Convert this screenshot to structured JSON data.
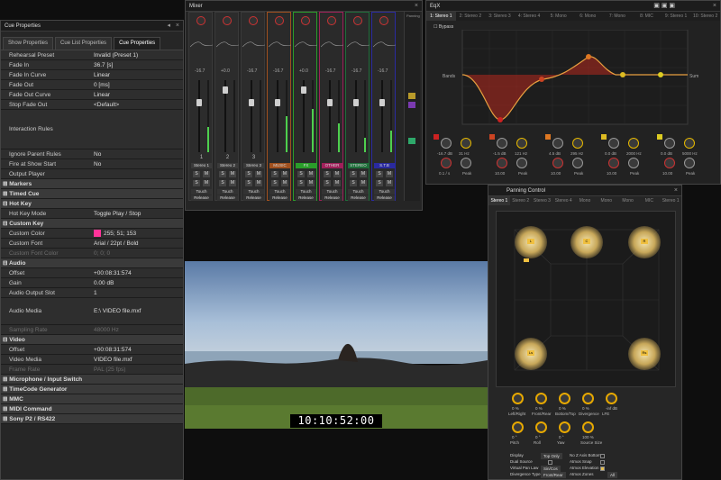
{
  "cue_panel": {
    "title": "Cue Properties",
    "tabs": [
      "Show Properties",
      "Cue List Properties",
      "Cue Properties"
    ],
    "rows": [
      {
        "k": "Rehearsal Preset",
        "v": "Invalid (Preset 1)"
      },
      {
        "k": "Fade In",
        "v": "36.7 [s]"
      },
      {
        "k": "Fade In Curve",
        "v": "Linear"
      },
      {
        "k": "Fade Out",
        "v": "0 [ms]"
      },
      {
        "k": "Fade Out Curve",
        "v": "Linear"
      },
      {
        "k": "Stop Fade Out",
        "v": "<Default>"
      },
      {
        "k": "Interaction Rules",
        "v": ""
      },
      {
        "k": "Ignore Parent Rules",
        "v": "No"
      },
      {
        "k": "Fire at Show Start",
        "v": "No"
      },
      {
        "k": "Output Player",
        "v": ""
      }
    ],
    "sections": {
      "markers": "Markers",
      "timed_cue": "Timed Cue",
      "hot_key": "Hot Key",
      "custom_key": "Custom Key",
      "audio": "Audio",
      "video": "Video",
      "microphone": "Microphone / Input Switch",
      "timecode": "TimeCode Generator",
      "mmc": "MMC",
      "midi": "MIDI Command",
      "sony": "Sony P2 / RS422"
    },
    "hot_key_mode": {
      "k": "Hot Key Mode",
      "v": "Toggle Play / Stop"
    },
    "custom_color": {
      "k": "Custom Color",
      "v": "255; 51; 153",
      "swatch": "#ff3399"
    },
    "custom_font": {
      "k": "Custom Font",
      "v": "Arial / 22pt / Bold"
    },
    "custom_font_color": {
      "k": "Custom Font Color",
      "v": "0; 0; 0"
    },
    "audio_rows": [
      {
        "k": "Offset",
        "v": "+00:08:31:574"
      },
      {
        "k": "Gain",
        "v": "0.00 dB"
      },
      {
        "k": "Audio Output Slot",
        "v": "1"
      },
      {
        "k": "Audio Media",
        "v": "E:\\  VIDEO file.mxf"
      },
      {
        "k": "Sampling Rate",
        "v": "48000 Hz"
      }
    ],
    "video_rows": [
      {
        "k": "Offset",
        "v": "+00:08:31:574"
      },
      {
        "k": "Video Media",
        "v": "VIDEO file.mxf"
      },
      {
        "k": "Frame Rate",
        "v": "PAL (25 fps)"
      }
    ]
  },
  "mixer": {
    "title": "Mixer",
    "channels": [
      {
        "num": "1",
        "name": "Stereo 1",
        "val": "-16.7",
        "color": "#2c2c2c",
        "fill": 0.35
      },
      {
        "num": "2",
        "name": "Stereo 2",
        "val": "+0.0",
        "color": "#2c2c2c",
        "fill": 0.0
      },
      {
        "num": "3",
        "name": "Stereo 3",
        "val": "-16.7",
        "color": "#2c2c2c",
        "fill": 0.0
      },
      {
        "num": "",
        "name": "MUSIC",
        "val": "-16.7",
        "color": "#a0501e",
        "fill": 0.5
      },
      {
        "num": "",
        "name": "FX",
        "val": "+0.0",
        "color": "#2a9d2a",
        "fill": 0.6
      },
      {
        "num": "",
        "name": "OTHER",
        "val": "-16.7",
        "color": "#a0205a",
        "fill": 0.4
      },
      {
        "num": "",
        "name": "STEREO",
        "val": "-16.7",
        "color": "#1e6e3a",
        "fill": 0.2
      },
      {
        "num": "",
        "name": "S.T.B",
        "val": "-16.7",
        "color": "#2a2aa0",
        "fill": 0.3
      }
    ],
    "buttons": {
      "s": "S",
      "m": "M",
      "touch": "Touch",
      "release": "Release"
    }
  },
  "eq": {
    "title": "EqX",
    "tabs": [
      "1: Stereo 1",
      "2: Stereo 2",
      "3: Stereo 3",
      "4: Stereo 4",
      "5: Mono",
      "6: Mono",
      "7: Mono",
      "8: MIC",
      "9: Stereo 1",
      "10: Stereo 2"
    ],
    "bypass": "Bypass",
    "db_left": [
      "+12",
      "+6",
      "0",
      "-6",
      "-12"
    ],
    "freq_ticks": [
      "10",
      "20",
      "50",
      "100",
      "200",
      "500",
      "1k",
      "2k",
      "5k",
      "10k",
      "20k"
    ],
    "bands": [
      {
        "gain": "-16.7 dB",
        "freq": "31 Hz",
        "q": "0.1 / s",
        "label": "Peak",
        "color": "#cc2222"
      },
      {
        "gain": "-1.5 dB",
        "freq": "121 Hz",
        "q": "10.00",
        "label": "Peak",
        "color": "#cc4422"
      },
      {
        "gain": "4.5 dB",
        "freq": "295 Hz",
        "q": "10.00",
        "label": "Peak",
        "color": "#dd7722"
      },
      {
        "gain": "0.0 dB",
        "freq": "2000 Hz",
        "q": "10.00",
        "label": "Peak",
        "color": "#ddbb22"
      },
      {
        "gain": "0.0 dB",
        "freq": "5000 Hz",
        "q": "10.00",
        "label": "Peak",
        "color": "#ddcc22"
      }
    ],
    "band_label": "Bands",
    "sum_label": "Sum"
  },
  "pan": {
    "title": "Panning Control",
    "tabs": [
      "Stereo 1",
      "Stereo 2",
      "Stereo 3",
      "Stereo 4",
      "Mono",
      "Mono",
      "Mono",
      "MIC",
      "Stereo 1"
    ],
    "speakers": [
      "L",
      "C",
      "R",
      "Ls",
      "Rs"
    ],
    "knobs1": [
      {
        "v": "0 %",
        "l": "Left/Right"
      },
      {
        "v": "0 %",
        "l": "Front/Rear"
      },
      {
        "v": "0 %",
        "l": "Bottom/Top"
      },
      {
        "v": "0 %",
        "l": "Divergence"
      },
      {
        "v": "-inf dB",
        "l": "LFE"
      }
    ],
    "knobs2": [
      {
        "v": "0 °",
        "l": "Pitch"
      },
      {
        "v": "0 °",
        "l": "Roll"
      },
      {
        "v": "0 °",
        "l": "Yaw"
      },
      {
        "v": "100 %",
        "l": "Source Size"
      }
    ],
    "options": [
      {
        "l": "Display",
        "v": "Top Only"
      },
      {
        "l": "Dual Source",
        "v": ""
      },
      {
        "l": "Virtual Pan Law",
        "v": "Sin/Cos"
      },
      {
        "l": "Divergence Type",
        "v": "Front/Rear"
      }
    ],
    "options2": [
      {
        "l": "No Z Axis Bottom",
        "v": ""
      },
      {
        "l": "Atmos Snap",
        "v": ""
      },
      {
        "l": "Atmos Elevation",
        "v": ""
      },
      {
        "l": "Atmos Zones",
        "v": "All"
      }
    ]
  },
  "video": {
    "timecode": "10:10:52:00"
  }
}
